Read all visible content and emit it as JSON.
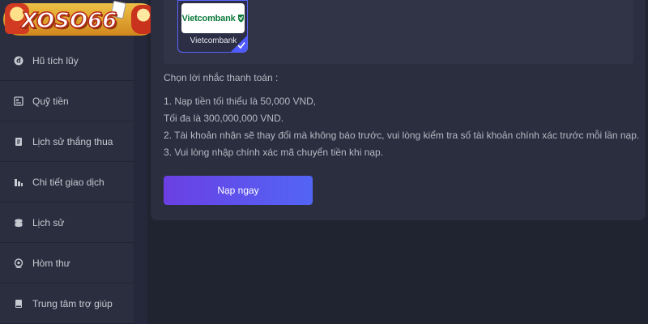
{
  "logo": {
    "text": "XOSO66"
  },
  "sidebar": {
    "items": [
      {
        "label": "Hũ tích lũy",
        "icon": "jar-icon"
      },
      {
        "label": "Quỹ tiền",
        "icon": "wallet-icon"
      },
      {
        "label": "Lịch sử thắng thua",
        "icon": "document-icon"
      },
      {
        "label": "Chi tiết giao dịch",
        "icon": "bars-icon"
      },
      {
        "label": "Lịch sử",
        "icon": "coins-icon"
      },
      {
        "label": "Hòm thư",
        "icon": "mail-icon"
      },
      {
        "label": "Trung tâm trợ giúp",
        "icon": "book-icon"
      }
    ]
  },
  "bank": {
    "logo_text": "Vietcombank",
    "name": "Vietcombank",
    "selected": true
  },
  "reminder": {
    "title": "Chọn lời nhắc thanh toán :",
    "notes": [
      "1. Nạp tiền tối thiểu là 50,000 VND,",
      "Tối đa là 300,000,000 VND.",
      "2. Tài khoản nhận sẽ thay đổi mà không báo trước, vui lòng kiểm tra số tài khoản chính xác trước mỗi lần nạp.",
      "3. Vui lòng nhập chính xác mã chuyển tiền khi nạp."
    ]
  },
  "deposit_button": {
    "label": "Nạp ngay"
  },
  "colors": {
    "accent_start": "#6b3fe3",
    "accent_end": "#5265f5",
    "bank_green": "#0c7a3b"
  }
}
